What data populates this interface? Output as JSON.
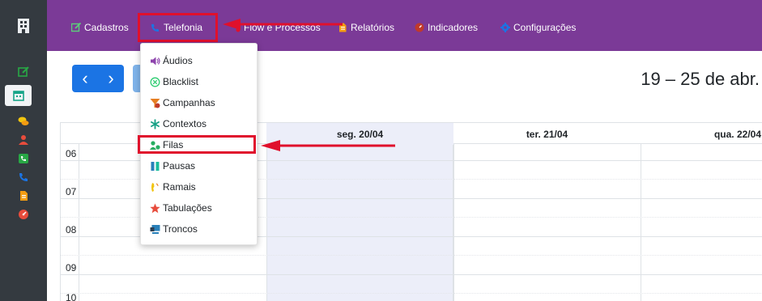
{
  "topbar": {
    "items": [
      {
        "label": "Cadastros",
        "icon": "edit-icon"
      },
      {
        "label": "Telefonia",
        "icon": "phone-icon"
      },
      {
        "label": "Flow e Processos",
        "icon": "flow-icon"
      },
      {
        "label": "Relatórios",
        "icon": "report-icon"
      },
      {
        "label": "Indicadores",
        "icon": "gauge-icon"
      },
      {
        "label": "Configurações",
        "icon": "gear-icon"
      }
    ]
  },
  "sidebar": {
    "icons": [
      "logo-icon",
      "edit-icon",
      "calendar-icon",
      "chat-icon",
      "user-icon",
      "phone-square-icon",
      "phone-icon",
      "file-icon",
      "gauge-icon"
    ]
  },
  "toolbar": {
    "prev_label": "‹",
    "next_label": "›"
  },
  "calendar": {
    "date_range": "19 – 25 de abr.",
    "columns": [
      "seg. 20/04",
      "ter. 21/04",
      "qua. 22/04"
    ],
    "hours": [
      "06",
      "07",
      "08",
      "09",
      "10"
    ]
  },
  "dropdown": {
    "items": [
      {
        "label": "Áudios",
        "icon": "volume-icon"
      },
      {
        "label": "Blacklist",
        "icon": "blocked-icon"
      },
      {
        "label": "Campanhas",
        "icon": "campaign-icon"
      },
      {
        "label": "Contextos",
        "icon": "asterisk-icon"
      },
      {
        "label": "Filas",
        "icon": "queue-icon"
      },
      {
        "label": "Pausas",
        "icon": "pause-icon"
      },
      {
        "label": "Ramais",
        "icon": "extension-icon"
      },
      {
        "label": "Tabulações",
        "icon": "star-icon"
      },
      {
        "label": "Troncos",
        "icon": "trunk-icon"
      }
    ]
  },
  "colors": {
    "topbar": "#7b3a97",
    "sidebar": "#343a40",
    "accent": "#1b74e4",
    "highlight": "#e0102c",
    "today": "#eceef9"
  }
}
